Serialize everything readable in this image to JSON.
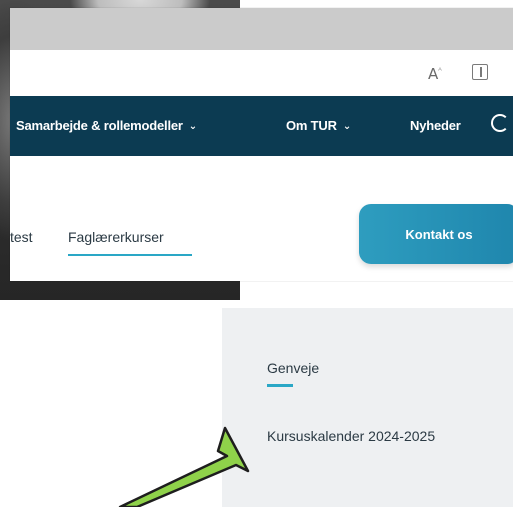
{
  "navbar": {
    "items": [
      {
        "label": "Samarbejde & rollemodeller",
        "chevron": "⌄"
      },
      {
        "label": "Om TUR",
        "chevron": "⌄"
      },
      {
        "label": "Nyheder"
      }
    ],
    "icons": {
      "search": "search-icon"
    }
  },
  "addressbar": {
    "read_aloud_icon": "A",
    "read_aloud_sup": "ᴬ"
  },
  "subnav": {
    "links": [
      "test",
      "Faglærerkurser"
    ],
    "contact_button": "Kontakt os"
  },
  "shortcuts": {
    "title": "Genveje",
    "links": [
      "Kursuskalender 2024-2025"
    ]
  },
  "colors": {
    "navbar_bg": "#0c3b52",
    "accent": "#2aa7c6",
    "button": "#2e9dbf",
    "panel_bg": "#eef0f2",
    "arrow_fill": "#8fd24a"
  }
}
